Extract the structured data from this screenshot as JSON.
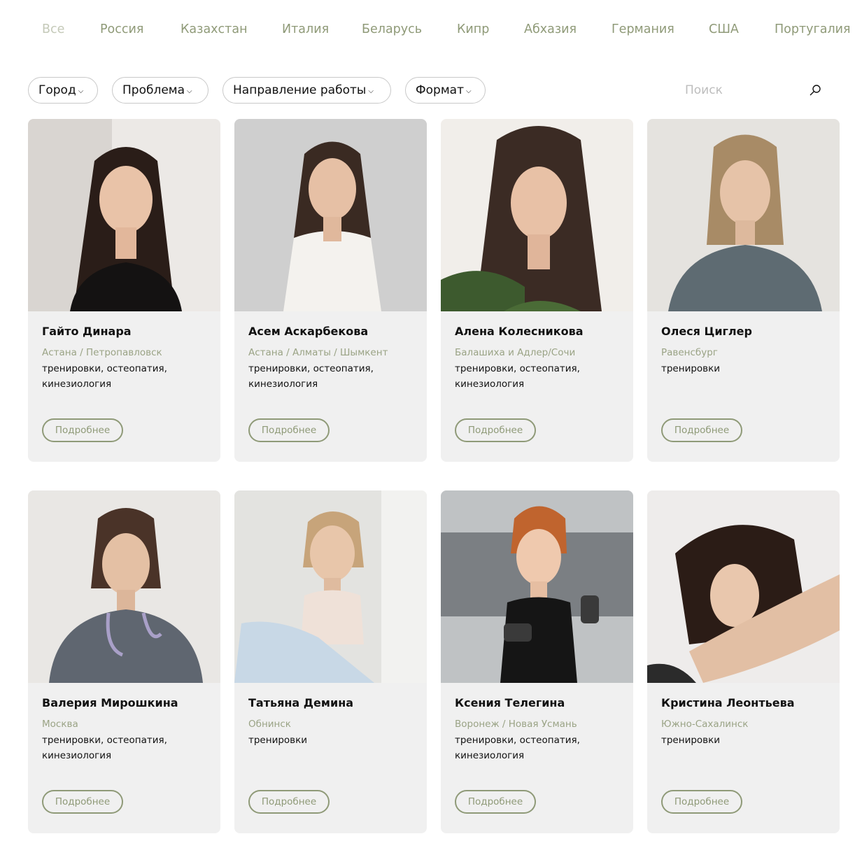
{
  "countries": [
    "Все",
    "Россия",
    "Казахстан",
    "Италия",
    "Беларусь",
    "Кипр",
    "Абхазия",
    "Германия",
    "США",
    "Португалия"
  ],
  "filters": {
    "city": "Город",
    "problem": "Проблема",
    "direction": "Направление работы",
    "format": "Формат"
  },
  "search": {
    "placeholder": "Поиск"
  },
  "more_label": "Подробнее",
  "specialists": [
    {
      "name": "Гайто Динара",
      "city": "Астана / Петропавловск",
      "spec": "тренировки, остеопатия, кинезиология"
    },
    {
      "name": "Асем Аскарбекова",
      "city": "Астана / Алматы / Шымкент",
      "spec": "тренировки, остеопатия, кинезиология"
    },
    {
      "name": "Алена Колесникова",
      "city": "Балашиха и Адлер/Сочи",
      "spec": "тренировки, остеопатия, кинезиология"
    },
    {
      "name": "Олеся Циглер",
      "city": "Равенсбург",
      "spec": "тренировки"
    },
    {
      "name": "Валерия Мирошкина",
      "city": "Москва",
      "spec": "тренировки, остеопатия, кинезиология"
    },
    {
      "name": "Татьяна Демина",
      "city": "Обнинск",
      "spec": "тренировки"
    },
    {
      "name": "Ксения Телегина",
      "city": "Воронеж / Новая Усмань",
      "spec": "тренировки, остеопатия, кинезиология"
    },
    {
      "name": "Кристина Леонтьева",
      "city": "Южно-Сахалинск",
      "spec": "тренировки"
    }
  ],
  "colors": {
    "accent": "#8f9a78",
    "card_bg": "#f0f0f0",
    "tab_active": "#c4c9b8"
  }
}
